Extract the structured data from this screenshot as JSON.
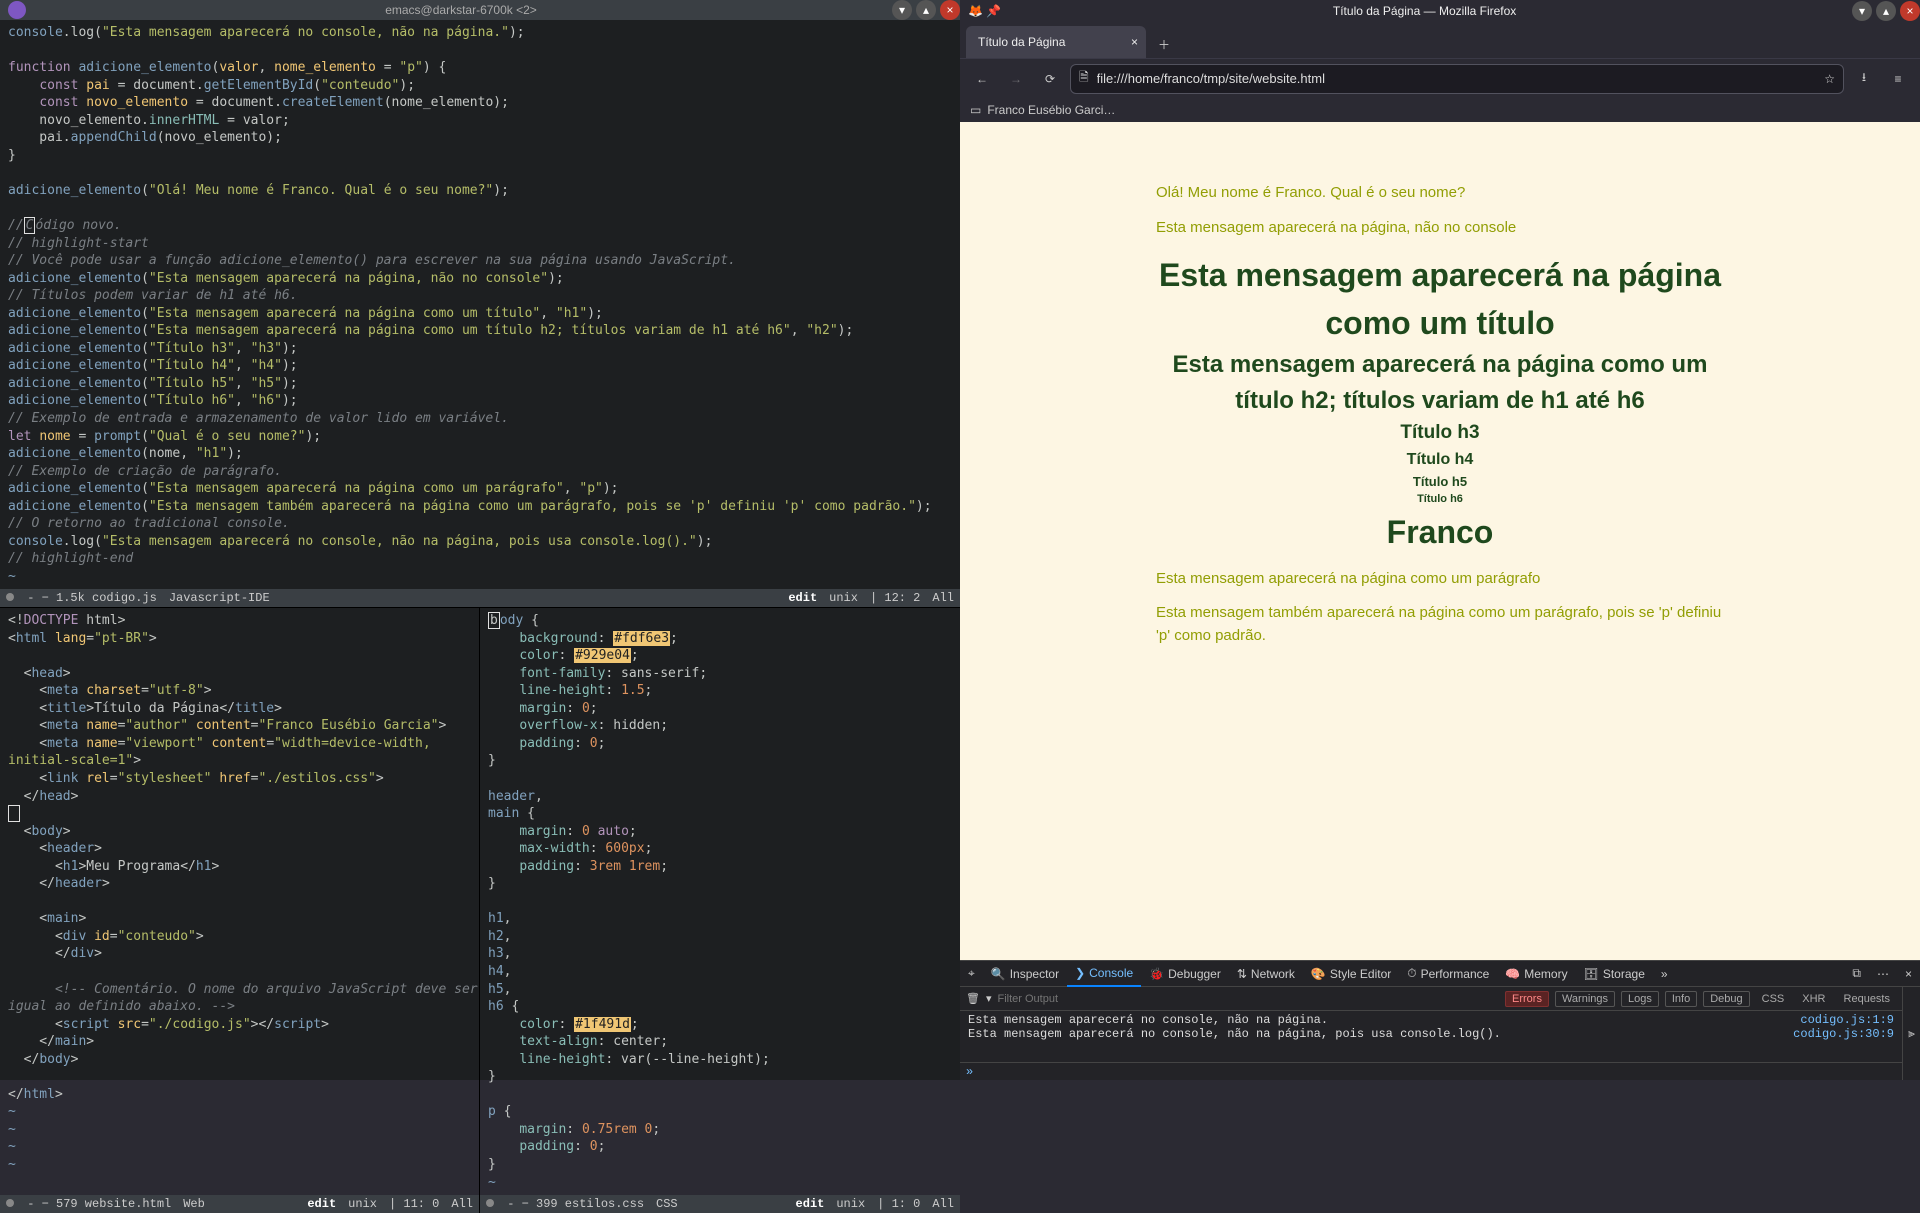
{
  "emacs": {
    "title": "emacs@darkstar-6700k <2>",
    "top": {
      "statusbar": {
        "left": " -  − 1.5k codigo.js",
        "mode": "Javascript-IDE",
        "edit": "edit",
        "enc": "unix",
        "pos": "12: 2",
        "scroll": "All"
      }
    },
    "bl": {
      "statusbar": {
        "left": " -  − 579 website.html",
        "mode": "Web",
        "edit": "edit",
        "enc": "unix",
        "pos": "11: 0",
        "scroll": "All"
      }
    },
    "br": {
      "statusbar": {
        "left": " -  − 399 estilos.css",
        "mode": "CSS",
        "edit": "edit",
        "enc": "unix",
        "pos": "1: 0",
        "scroll": "All"
      }
    }
  },
  "firefox": {
    "window_title": "Título da Página — Mozilla Firefox",
    "tab_title": "Título da Página",
    "url": "file:///home/franco/tmp/site/website.html",
    "bookmark": "Franco Eusébio Garci…",
    "page": {
      "p0": "Olá! Meu nome é Franco. Qual é o seu nome?",
      "p1": "Esta mensagem aparecerá na página, não no console",
      "h1": "Esta mensagem aparecerá na página como um título",
      "h2": "Esta mensagem aparecerá na página como um título h2; títulos variam de h1 até h6",
      "h3": "Título h3",
      "h4": "Título h4",
      "h5": "Título h5",
      "h6": "Título h6",
      "h1b": "Franco",
      "p2": "Esta mensagem aparecerá na página como um parágrafo",
      "p3": "Esta mensagem também aparecerá na página como um parágrafo, pois se 'p' definiu 'p' como padrão."
    },
    "devtools": {
      "tabs": [
        "Inspector",
        "Console",
        "Debugger",
        "Network",
        "Style Editor",
        "Performance",
        "Memory",
        "Storage"
      ],
      "filter_placeholder": "Filter Output",
      "chips": [
        "Errors",
        "Warnings",
        "Logs",
        "Info",
        "Debug",
        "CSS",
        "XHR",
        "Requests"
      ],
      "rows": [
        {
          "msg": "Esta mensagem aparecerá no console, não na página.",
          "src": "codigo.js:1:9"
        },
        {
          "msg": "Esta mensagem aparecerá no console, não na página, pois usa console.log().",
          "src": "codigo.js:30:9"
        }
      ]
    }
  },
  "code_top": "console.log(\"Esta mensagem aparecerá no console, não na página.\");\n\nfunction adicione_elemento(valor, nome_elemento = \"p\") {\n    const pai = document.getElementById(\"conteudo\");\n    const novo_elemento = document.createElement(nome_elemento);\n    novo_elemento.innerHTML = valor;\n    pai.appendChild(novo_elemento);\n}\n\nadicione_elemento(\"Olá! Meu nome é Franco. Qual é o seu nome?\");\n\n// Código novo.\n// highlight-start\n// Você pode usar a função adicione_elemento() para escrever na sua página usando JavaScript.\nadicione_elemento(\"Esta mensagem aparecerá na página, não no console\");\n// Títulos podem variar de h1 até h6.\nadicione_elemento(\"Esta mensagem aparecerá na página como um título\", \"h1\");\nadicione_elemento(\"Esta mensagem aparecerá na página como um título h2; títulos variam de h1 até h6\", \"h2\");\nadicione_elemento(\"Título h3\", \"h3\");\nadicione_elemento(\"Título h4\", \"h4\");\nadicione_elemento(\"Título h5\", \"h5\");\nadicione_elemento(\"Título h6\", \"h6\");\n// Exemplo de entrada e armazenamento de valor lido em variável.\nlet nome = prompt(\"Qual é o seu nome?\");\nadicione_elemento(nome, \"h1\");\n// Exemplo de criação de parágrafo.\nadicione_elemento(\"Esta mensagem aparecerá na página como um parágrafo\", \"p\");\nadicione_elemento(\"Esta mensagem também aparecerá na página como um parágrafo, pois se 'p' definiu 'p' como padrão.\");\n// O retorno ao tradicional console.\nconsole.log(\"Esta mensagem aparecerá no console, não na página, pois usa console.log().\");\n// highlight-end",
  "code_bl": "<!DOCTYPE html>\n<html lang=\"pt-BR\">\n\n  <head>\n    <meta charset=\"utf-8\">\n    <title>Título da Página</title>\n    <meta name=\"author\" content=\"Franco Eusébio Garcia\">\n    <meta name=\"viewport\" content=\"width=device-width, initial-scale=1\">\n    <link rel=\"stylesheet\" href=\"./estilos.css\">\n  </head>\n\n  <body>\n    <header>\n      <h1>Meu Programa</h1>\n    </header>\n\n    <main>\n      <div id=\"conteudo\">\n      </div>\n\n      <!-- Comentário. O nome do arquivo JavaScript deve ser igual ao definido abaixo. -->\n      <script src=\"./codigo.js\"></script>\n    </main>\n  </body>\n\n</html>",
  "code_br": "body {\n    background: #fdf6e3;\n    color: #929e04;\n    font-family: sans-serif;\n    line-height: 1.5;\n    margin: 0;\n    overflow-x: hidden;\n    padding: 0;\n}\n\nheader,\nmain {\n    margin: 0 auto;\n    max-width: 600px;\n    padding: 3rem 1rem;\n}\n\nh1,\nh2,\nh3,\nh4,\nh5,\nh6 {\n    color: #1f491d;\n    text-align: center;\n    line-height: var(--line-height);\n}\n\np {\n    margin: 0.75rem 0;\n    padding: 0;\n}"
}
